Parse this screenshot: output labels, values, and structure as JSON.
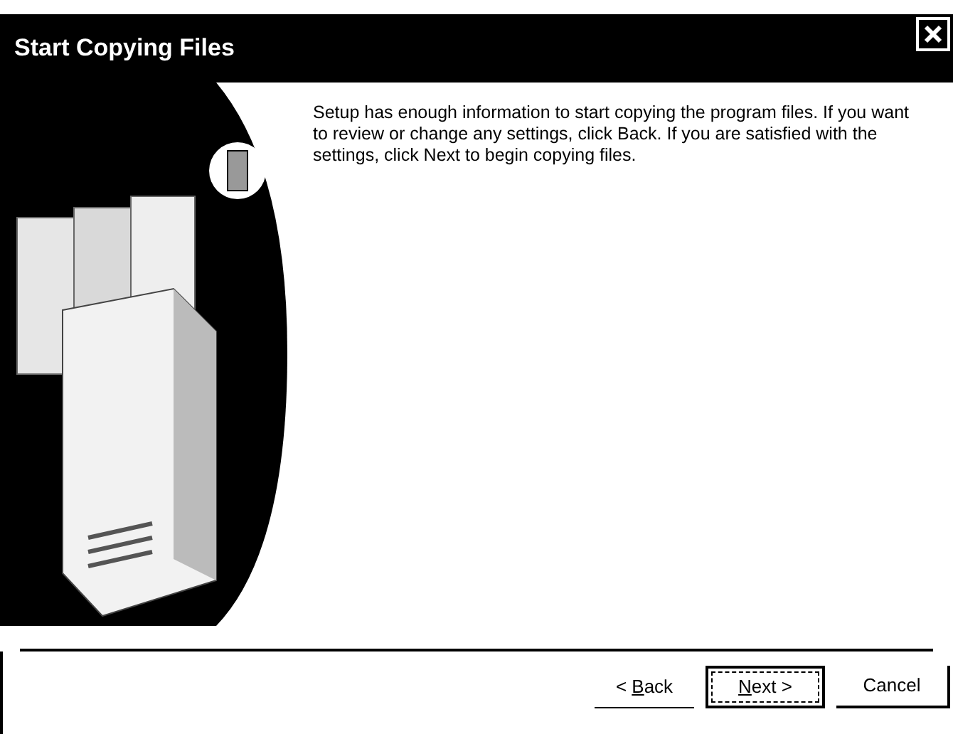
{
  "window": {
    "title": "Start Copying Files"
  },
  "message": "Setup has enough information to start copying the program files. If you want to review or change any settings, click Back.  If you are satisfied with the settings, click Next to begin copying files.",
  "buttons": [
    {
      "prefix": "< ",
      "mnemonic": "B",
      "rest": "ack",
      "default": false
    },
    {
      "mnemonic": "N",
      "rest": "ext >",
      "default": true
    },
    {
      "label": "Cancel",
      "default": false
    }
  ]
}
